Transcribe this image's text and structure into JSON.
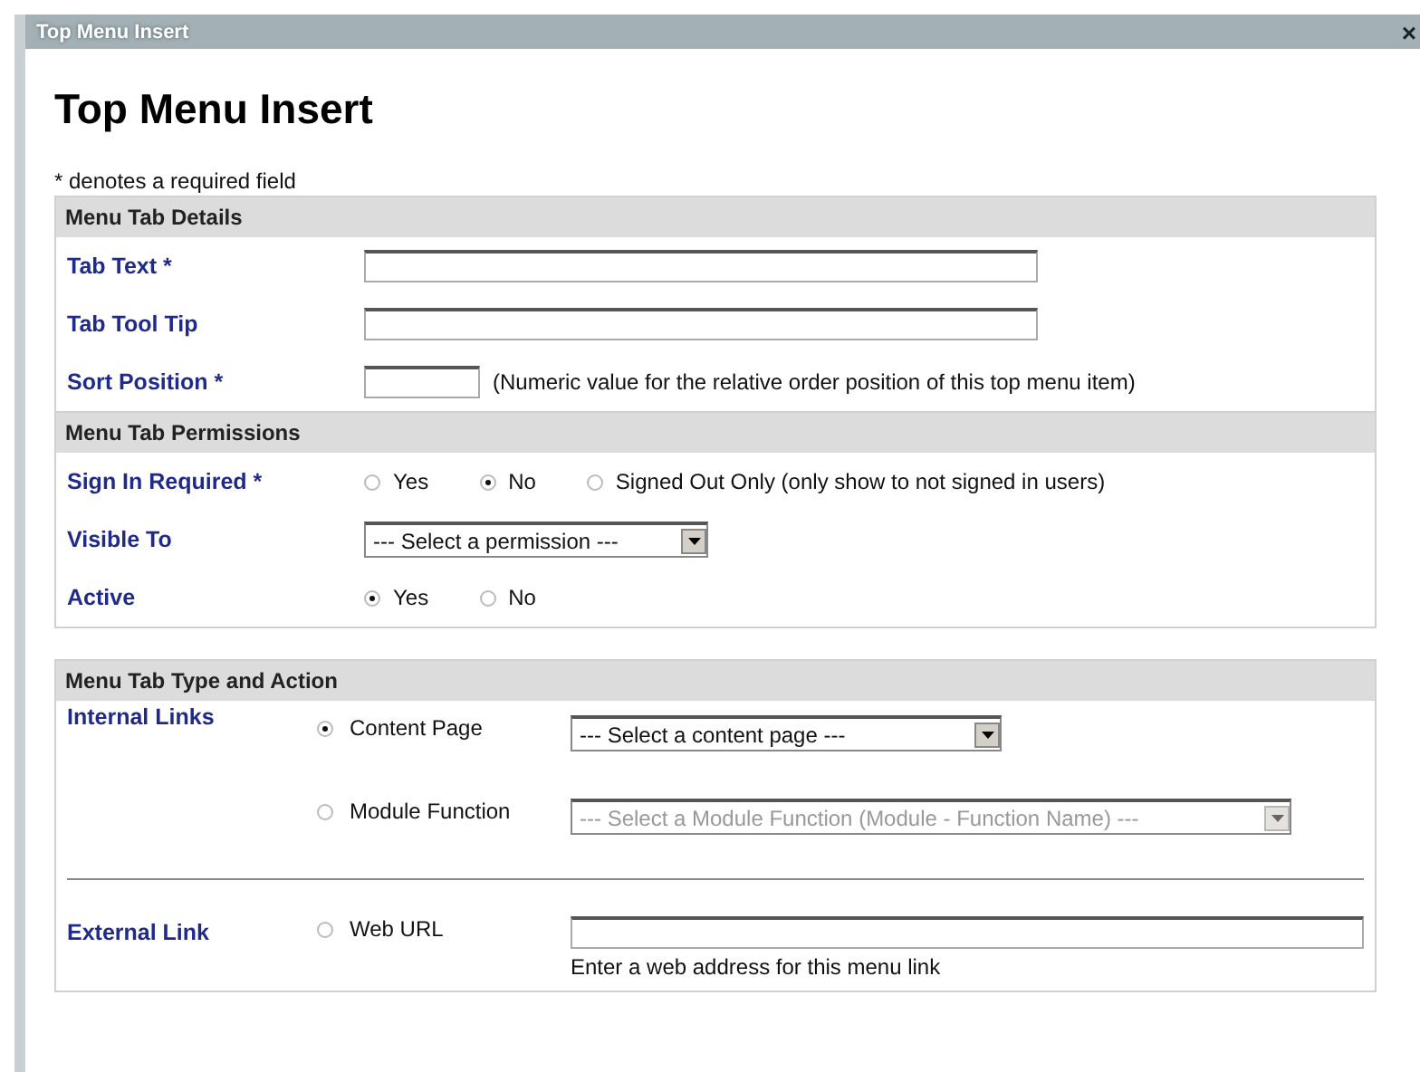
{
  "window": {
    "title": "Top Menu Insert",
    "close": "×"
  },
  "heading": "Top Menu Insert",
  "required_note": "* denotes a required field",
  "sections": [
    {
      "title": "Menu Tab Details",
      "rows": [
        {
          "kind": "text",
          "label": "Tab Text *"
        },
        {
          "kind": "text",
          "label": "Tab Tool Tip"
        },
        {
          "kind": "short_text",
          "label": "Sort Position *",
          "note": "(Numeric value for the relative order position of this top menu item)"
        }
      ]
    },
    {
      "title": "Menu Tab Permissions",
      "rows": [
        {
          "kind": "radios",
          "label": "Sign In Required *",
          "options": [
            {
              "label": "Yes",
              "selected": false
            },
            {
              "label": "No",
              "selected": true
            },
            {
              "label": "Signed Out Only (only show to not signed in users)",
              "selected": false
            }
          ]
        },
        {
          "kind": "select",
          "label": "Visible To",
          "value": "--- Select a permission ---"
        },
        {
          "kind": "radios",
          "label": "Active",
          "options": [
            {
              "label": "Yes",
              "selected": true
            },
            {
              "label": "No",
              "selected": false
            }
          ]
        }
      ]
    },
    {
      "title": "Menu Tab Type and Action",
      "rows": [
        {
          "kind": "choices",
          "label": "Internal Links",
          "options": [
            {
              "label": "Content Page",
              "selected": true,
              "select": {
                "value": "--- Select a content page ---",
                "disabled": false
              }
            },
            {
              "label": "Module Function",
              "selected": false,
              "select": {
                "value": "--- Select a Module Function (Module - Function Name) ---",
                "disabled": true
              }
            }
          ]
        },
        {
          "kind": "divider"
        },
        {
          "kind": "url",
          "label": "External Link",
          "option": {
            "label": "Web URL",
            "selected": false
          },
          "hint": "Enter a web address for this menu link"
        }
      ]
    }
  ]
}
